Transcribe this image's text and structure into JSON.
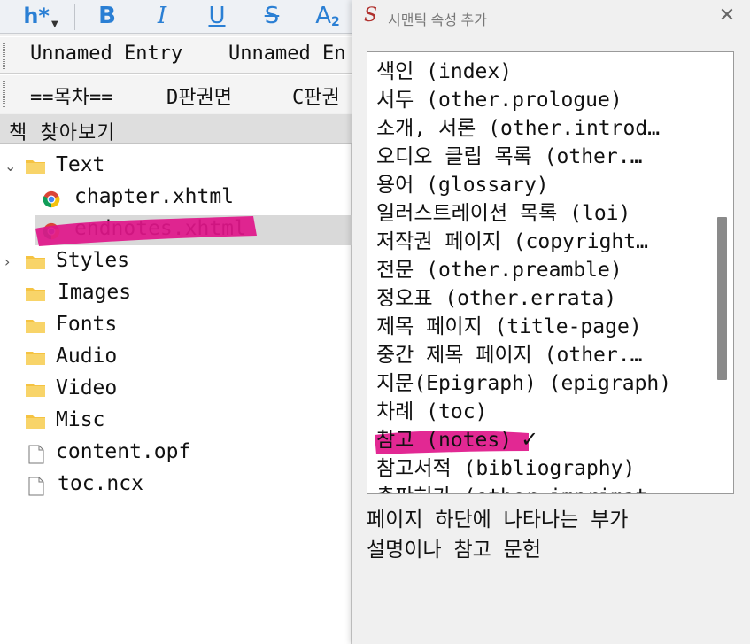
{
  "toolbar": {
    "heading_button": "h*",
    "bold_button": "B",
    "italic_button": "I",
    "underline_button": "U",
    "strike_button": "S",
    "subscript_button": "A",
    "subscript_suffix": "2"
  },
  "clipbar1": {
    "items": [
      "Unnamed Entry",
      "Unnamed En"
    ]
  },
  "clipbar2": {
    "items": [
      "==목차==",
      "D판권면",
      "C판권"
    ]
  },
  "book_browser": {
    "title": "책 찾아보기",
    "tree": [
      {
        "label": "Text",
        "type": "folder",
        "expanded": true
      },
      {
        "label": "chapter.xhtml",
        "type": "file-html"
      },
      {
        "label": "endnotes.xhtml",
        "type": "file-html",
        "selected": true
      },
      {
        "label": "Styles",
        "type": "folder",
        "expanded": false
      },
      {
        "label": "Images",
        "type": "folder"
      },
      {
        "label": "Fonts",
        "type": "folder"
      },
      {
        "label": "Audio",
        "type": "folder"
      },
      {
        "label": "Video",
        "type": "folder"
      },
      {
        "label": "Misc",
        "type": "folder"
      },
      {
        "label": "content.opf",
        "type": "file"
      },
      {
        "label": "toc.ncx",
        "type": "file"
      }
    ]
  },
  "dialog": {
    "logo": "S",
    "title": "시맨틱 속성 추가",
    "close": "✕",
    "items": [
      "색인 (index)",
      "서두 (other.prologue)",
      "소개, 서론 (other.introd…",
      "오디오 클립 목록 (other.…",
      "용어 (glossary)",
      "일러스트레이션 목록 (loi)",
      "저작권 페이지 (copyright…",
      "전문 (other.preamble)",
      "정오표 (other.errata)",
      "제목 페이지 (title-page)",
      "중간 제목 페이지 (other.…",
      "지문(Epigraph) (epigraph)",
      "차례 (toc)",
      "참고 (notes)",
      "참고서적 (bibliography)",
      "출판허가 (other.imprimat…"
    ],
    "checked_index": 13,
    "check_mark": "✓",
    "description_line1": "페이지 하단에 나타나는 부가",
    "description_line2": "설명이나 참고 문헌"
  },
  "colors": {
    "highlight": "#e0168a",
    "toolbar_icon": "#2a7fd4",
    "folder": "#f5c342",
    "selection": "#d9d9d9"
  }
}
